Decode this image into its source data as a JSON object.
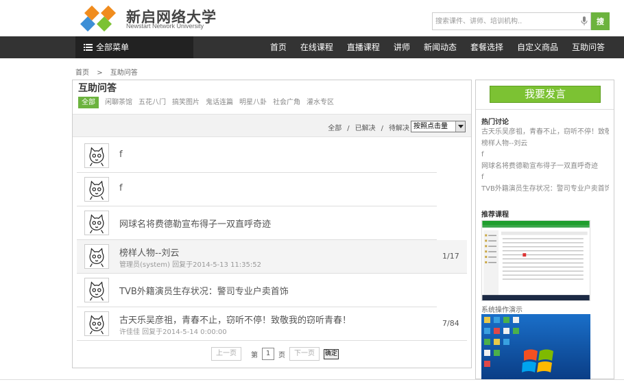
{
  "brand": {
    "title": "新启网络大学",
    "subtitle": "Newstart Network University",
    "colors": {
      "orange": "#f08c1e",
      "blue": "#3d8fd6",
      "green": "#7cc233",
      "accent": "#6cb33e"
    }
  },
  "search": {
    "placeholder": "搜索课件、讲师、培训机构..",
    "button_label": "搜",
    "mic_icon": "mic-icon"
  },
  "nav": {
    "all_menu": "全部菜单",
    "links": [
      "首页",
      "在线课程",
      "直播课程",
      "讲师",
      "新闻动态",
      "套餐选择",
      "自定义商品",
      "互助问答"
    ]
  },
  "breadcrumb": {
    "home": "首页",
    "sep": ">",
    "current": "互助问答"
  },
  "main": {
    "title": "互助问答",
    "categories": [
      "全部",
      "闲聊茶馆",
      "五花八门",
      "搞笑图片",
      "鬼话连篇",
      "明星八卦",
      "社会广角",
      "灌水专区"
    ],
    "filters": {
      "all": "全部",
      "resolved": "已解决",
      "pending": "待解决",
      "sep": "/",
      "sort_selected": "按照点击量"
    },
    "topics": [
      {
        "title": "f",
        "meta": "",
        "count": ""
      },
      {
        "title": "f",
        "meta": "",
        "count": ""
      },
      {
        "title": "网球名将费德勒宣布得子一双直呼奇迹",
        "meta": "",
        "count": ""
      },
      {
        "title": "榜样人物--刘云",
        "meta": "管理员(system) 回复于2014-5-13 11:35:52",
        "count": "1/17"
      },
      {
        "title": "TVB外籍演员生存状况：警司专业户卖首饰",
        "meta": "",
        "count": ""
      },
      {
        "title": "古天乐吴彦祖，青春不止，窃听不停！致敬我的窃听青春！",
        "meta": "许佳佳 回复于2014-5-14 0:00:00",
        "count": "7/84"
      }
    ],
    "pager": {
      "prev": "上一页",
      "page_label_a": "第",
      "page_value": "1",
      "page_label_b": "页",
      "next": "下一页",
      "go": "确定"
    }
  },
  "sidebar": {
    "post_button": "我要发言",
    "hot_title": "热门讨论",
    "hot_items": [
      "古天乐吴彦祖，青春不止，窃听不停！致敬",
      "榜样人物--刘云",
      "f",
      "网球名将费德勒宣布得子一双直呼奇迹",
      "f",
      "TVB外籍演员生存状况：警司专业户卖首饰"
    ],
    "rec_title": "推荐课程",
    "course_caption_1": "系统操作演示"
  }
}
